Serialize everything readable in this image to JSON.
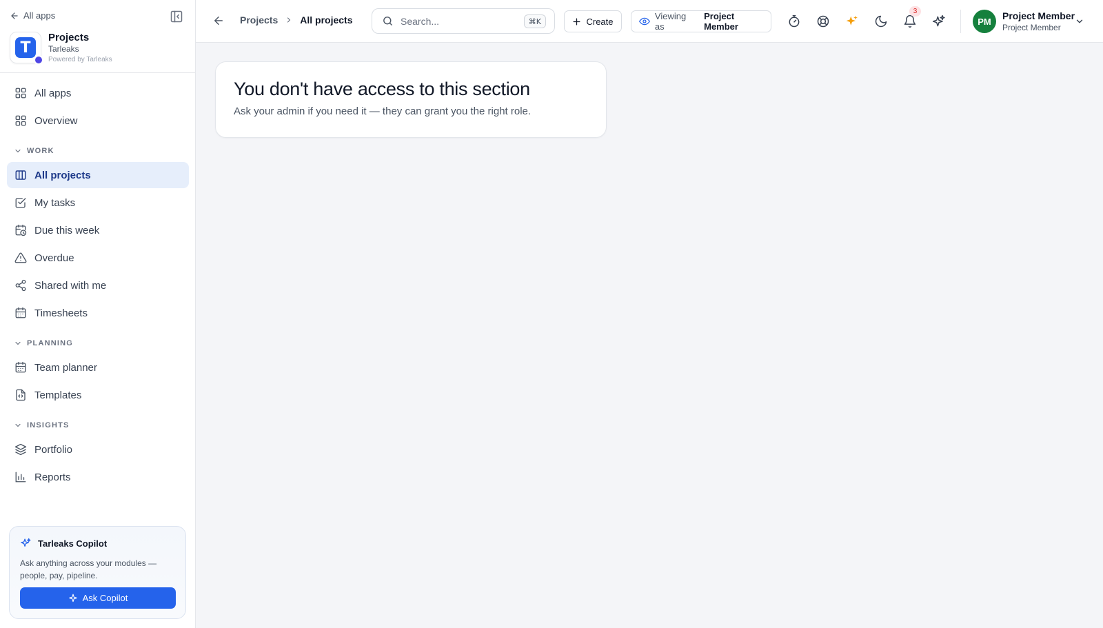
{
  "sidebar": {
    "back_label": "All apps",
    "brand": {
      "title": "Projects",
      "org": "Tarleaks",
      "powered": "Powered by Tarleaks",
      "logo_letter": "T"
    },
    "items": [
      {
        "label": "All apps",
        "icon": "grid-icon"
      },
      {
        "label": "Overview",
        "icon": "grid-icon"
      }
    ],
    "sections": [
      {
        "title": "WORK",
        "items": [
          {
            "label": "All projects",
            "icon": "briefcase-icon",
            "active": true
          },
          {
            "label": "My tasks",
            "icon": "checkbox-icon"
          },
          {
            "label": "Due this week",
            "icon": "calendar-clock-icon"
          },
          {
            "label": "Overdue",
            "icon": "warning-icon"
          },
          {
            "label": "Shared with me",
            "icon": "share-icon"
          },
          {
            "label": "Timesheets",
            "icon": "calendar-icon"
          }
        ]
      },
      {
        "title": "PLANNING",
        "items": [
          {
            "label": "Team planner",
            "icon": "calendar-icon"
          },
          {
            "label": "Templates",
            "icon": "file-code-icon"
          }
        ]
      },
      {
        "title": "INSIGHTS",
        "items": [
          {
            "label": "Portfolio",
            "icon": "layers-icon"
          },
          {
            "label": "Reports",
            "icon": "bar-chart-icon"
          }
        ]
      }
    ],
    "copilot": {
      "title": "Tarleaks Copilot",
      "description": "Ask anything across your modules — people, pay, pipeline.",
      "button": "Ask Copilot"
    }
  },
  "topbar": {
    "breadcrumb": {
      "parent": "Projects",
      "current": "All projects"
    },
    "search": {
      "placeholder": "Search...",
      "shortcut": "⌘K"
    },
    "create_label": "Create",
    "viewing": {
      "prefix": "Viewing as",
      "role": "Project Member"
    },
    "notifications_count": "3",
    "user": {
      "initials": "PM",
      "name": "Project Member",
      "role": "Project Member"
    }
  },
  "main": {
    "title": "You don't have access to this section",
    "subtitle": "Ask your admin if you need it — they can grant you the right role."
  },
  "colors": {
    "accent": "#2563eb",
    "active_bg": "#e6eefb",
    "avatar": "#15803d",
    "sparkle": "#f59e0b"
  }
}
